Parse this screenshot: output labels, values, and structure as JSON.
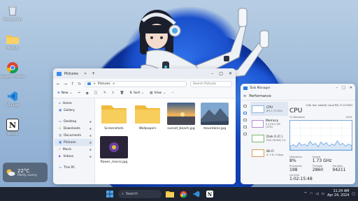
{
  "desktop": {
    "icons": [
      {
        "label": "Recycle Bin",
        "icon": "recycle-bin-icon"
      },
      {
        "label": "Projects",
        "icon": "folder-icon"
      },
      {
        "label": "Google Chrome",
        "icon": "chrome-icon"
      },
      {
        "label": "VS Code",
        "icon": "vscode-icon"
      },
      {
        "label": "Notion",
        "icon": "notion-icon"
      }
    ]
  },
  "weather": {
    "temp": "22°C",
    "condition": "Partly sunny"
  },
  "explorer": {
    "title": "Pictures",
    "address": [
      "Pictures",
      ">"
    ],
    "search_placeholder": "Search Pictures",
    "toolbar": {
      "new": "New",
      "sort": "Sort",
      "view": "View"
    },
    "sidebar": [
      {
        "label": "Home",
        "icon": "home-icon"
      },
      {
        "label": "Gallery",
        "icon": "gallery-icon"
      },
      {
        "label": "Desktop",
        "icon": "desktop-icon",
        "pinned": true
      },
      {
        "label": "Downloads",
        "icon": "download-icon",
        "pinned": true
      },
      {
        "label": "Documents",
        "icon": "document-icon",
        "pinned": true
      },
      {
        "label": "Pictures",
        "icon": "pictures-icon",
        "pinned": true,
        "active": true
      },
      {
        "label": "Music",
        "icon": "music-icon",
        "pinned": true
      },
      {
        "label": "Videos",
        "icon": "video-icon",
        "pinned": true
      },
      {
        "label": "This PC",
        "icon": "pc-icon"
      }
    ],
    "items": [
      {
        "name": "Screenshots",
        "kind": "folder"
      },
      {
        "name": "Wallpapers",
        "kind": "folder"
      },
      {
        "name": "sunset_beach.jpg",
        "kind": "image-sunset"
      },
      {
        "name": "mountains.jpg",
        "kind": "image-mountain"
      },
      {
        "name": "flower_macro.jpg",
        "kind": "image-flower"
      }
    ]
  },
  "taskmgr": {
    "title": "Task Manager",
    "section": "Performance",
    "items": [
      {
        "name": "CPU",
        "value": "8%  1.73 GHz"
      },
      {
        "name": "Memory",
        "value": "5.1/16.0 GB (32%)"
      },
      {
        "name": "Disk 0 (C:)",
        "value": "SSD (NVMe) 1%"
      },
      {
        "name": "Wi-Fi",
        "value": "S: 0  R: 0 Kbps"
      }
    ],
    "main_title": "CPU",
    "model": "12th Gen Intel(R) Core(TM) i7-12700H",
    "util_label": "% Utilization",
    "util_max": "100%",
    "stats": [
      {
        "k": "Utilization",
        "v": "8%"
      },
      {
        "k": "Speed",
        "v": "1.73 GHz"
      },
      {
        "k": "",
        "v": ""
      },
      {
        "k": "Processes",
        "v": "198"
      },
      {
        "k": "Threads",
        "v": "2860"
      },
      {
        "k": "Handles",
        "v": "94211"
      },
      {
        "k": "Up time",
        "v": "1:02:15:48"
      }
    ]
  },
  "taskbar": {
    "search": "Search",
    "time": "11:24 AM",
    "date": "Apr 24, 2024"
  },
  "colors": {
    "taskbar": "#1d2330",
    "accent": "#1a5fd0"
  }
}
